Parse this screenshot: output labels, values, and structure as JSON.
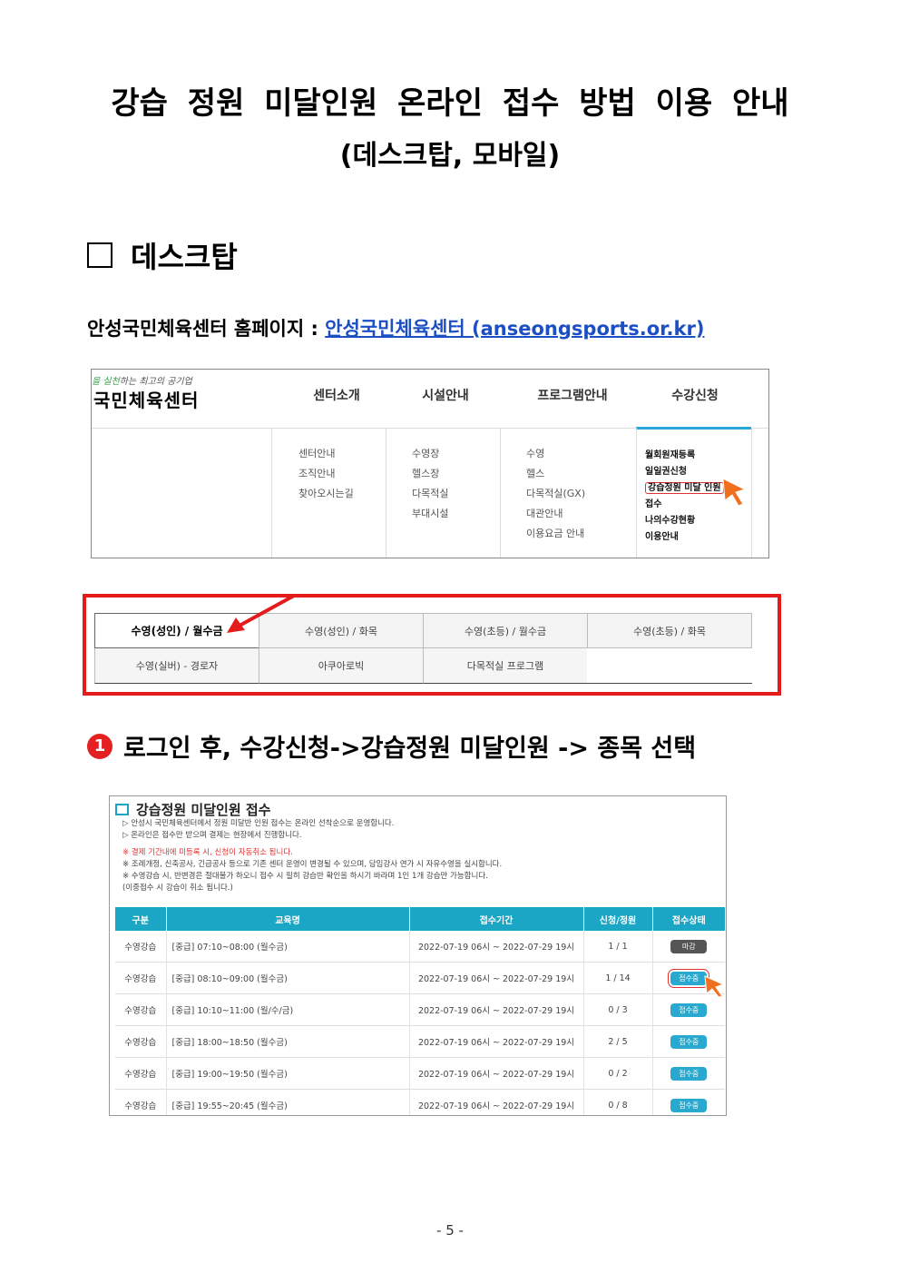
{
  "title": {
    "line1": "강습 정원 미달인원 온라인 접수 방법 이용 안내",
    "line2": "(데스크탑, 모바일)"
  },
  "section": {
    "label": "데스크탑"
  },
  "homepage": {
    "label": "안성국민체육센터 홈페이지 : ",
    "link_text": "안성국민체육센터 (anseongsports.or.kr)"
  },
  "menu_shot": {
    "logo_small_green": "을 실천",
    "logo_small_rest": "하는 최고의 공기업",
    "logo_big": "국민체육센터",
    "top_menu": [
      "센터소개",
      "시설안내",
      "프로그램안내",
      "수강신청"
    ],
    "columns": [
      [
        "센터안내",
        "조직안내",
        "찾아오시는길"
      ],
      [
        "수영장",
        "헬스장",
        "다목적실",
        "부대시설"
      ],
      [
        "수영",
        "헬스",
        "다목적실(GX)",
        "대관안내",
        "이용요금 안내"
      ],
      [
        "월회원재등록",
        "일일권신청",
        "강습정원 미달 인원",
        "접수",
        "나의수강현황",
        "이용안내"
      ]
    ]
  },
  "tabs": {
    "row1": [
      "수영(성인) / 월수금",
      "수영(성인) / 화목",
      "수영(초등) / 월수금",
      "수영(초등) / 화목"
    ],
    "row2": [
      "수영(실버) - 경로자",
      "아쿠아로빅",
      "다목적실 프로그램"
    ]
  },
  "step1": {
    "number": "1",
    "text": "로그인 후, 수강신청->강습정원 미달인원 -> 종목 선택"
  },
  "table_shot": {
    "title": "강습정원 미달인원 접수",
    "notes": [
      "▷ 안성시 국민체육센터에서 정원 미달반 인원 접수는 온라인 선착순으로 운영합니다.",
      "▷ 온라인은 접수만 받으며 결제는 현장에서 진행합니다."
    ],
    "warn": "※ 결제 기간내에 미등록 시, 신청이 자동취소 됩니다.",
    "notes2": [
      "※ 조례개정, 신축공사, 긴급공사 등으로 기존 센터 운영이 변경될 수 있으며, 담임강사 연가 시 자유수영을 실시합니다.",
      "※ 수영강습 시, 반변경은 절대불가 하오니 접수 시 필히 강습반 확인을 하시기 바라며 1인 1개 강습만 가능합니다.",
      "(이중접수 시 강습이 취소 됩니다.)"
    ],
    "headers": [
      "구분",
      "교육명",
      "접수기간",
      "신청/정원",
      "접수상태"
    ],
    "rows": [
      {
        "type": "수영강습",
        "name": "[중급] 07:10~08:00 (월수금)",
        "period": "2022-07-19 06시 ~ 2022-07-29 19시",
        "count": "1 / 1",
        "status": "마감"
      },
      {
        "type": "수영강습",
        "name": "[중급] 08:10~09:00 (월수금)",
        "period": "2022-07-19 06시 ~ 2022-07-29 19시",
        "count": "1 / 14",
        "status": "접수중"
      },
      {
        "type": "수영강습",
        "name": "[중급] 10:10~11:00 (월/수/금)",
        "period": "2022-07-19 06시 ~ 2022-07-29 19시",
        "count": "0 / 3",
        "status": "접수중"
      },
      {
        "type": "수영강습",
        "name": "[중급] 18:00~18:50 (월수금)",
        "period": "2022-07-19 06시 ~ 2022-07-29 19시",
        "count": "2 / 5",
        "status": "접수중"
      },
      {
        "type": "수영강습",
        "name": "[중급] 19:00~19:50 (월수금)",
        "period": "2022-07-19 06시 ~ 2022-07-29 19시",
        "count": "0 / 2",
        "status": "접수중"
      },
      {
        "type": "수영강습",
        "name": "[중급] 19:55~20:45 (월수금)",
        "period": "2022-07-19 06시 ~ 2022-07-29 19시",
        "count": "0 / 8",
        "status": "접수중"
      }
    ]
  },
  "page_number": "- 5 -"
}
